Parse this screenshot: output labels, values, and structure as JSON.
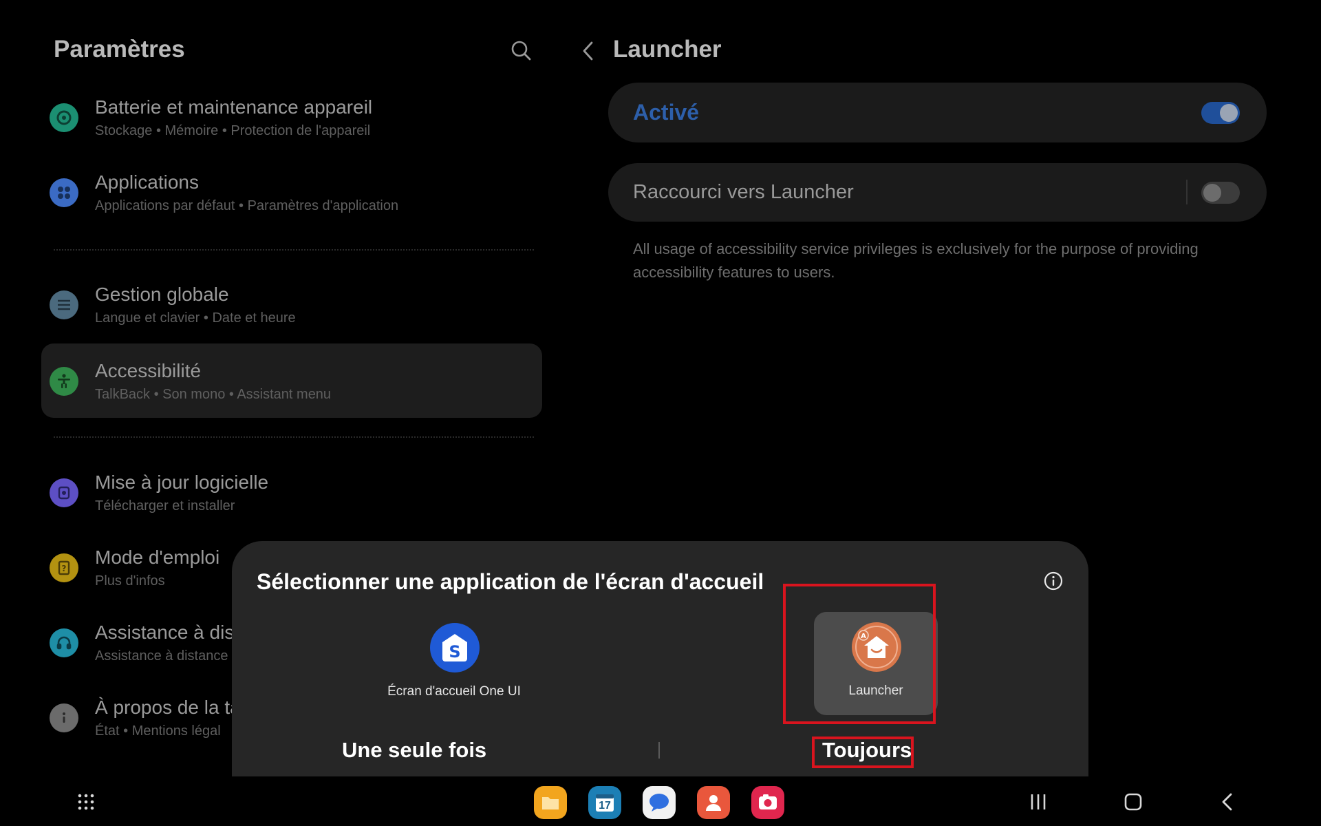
{
  "settings_pane": {
    "title": "Paramètres",
    "items": [
      {
        "title": "Batterie et maintenance appareil",
        "subtitle": "Stockage  •  Mémoire  •  Protection de l'appareil",
        "icon": "battery-care-icon",
        "color": "#1b8f72"
      },
      {
        "title": "Applications",
        "subtitle": "Applications par défaut  •  Paramètres d'application",
        "icon": "apps-grid-icon",
        "color": "#3b6bc4"
      },
      {
        "title": "Gestion globale",
        "subtitle": "Langue et clavier  •  Date et heure",
        "icon": "sliders-icon",
        "color": "#4b6a7e"
      },
      {
        "title": "Accessibilité",
        "subtitle": "TalkBack  •  Son mono  •  Assistant menu",
        "icon": "accessibility-icon",
        "color": "#2f8a46"
      },
      {
        "title": "Mise à jour logicielle",
        "subtitle": "Télécharger et installer",
        "icon": "software-update-icon",
        "color": "#5d4fc4"
      },
      {
        "title": "Mode d'emploi",
        "subtitle": "Plus d'infos",
        "icon": "manual-icon",
        "color": "#b39211"
      },
      {
        "title": "Assistance à dis",
        "subtitle": "Assistance à distance",
        "icon": "headset-icon",
        "color": "#1e8ea6"
      },
      {
        "title": "À propos de la ta",
        "subtitle": "État  •  Mentions légal",
        "icon": "info-icon",
        "color": "#6b6b6b"
      }
    ]
  },
  "detail_pane": {
    "title": "Launcher",
    "main_switch": {
      "label": "Activé",
      "state": "on"
    },
    "shortcut": {
      "label": "Raccourci vers Launcher",
      "state": "off"
    },
    "notice": "All usage of accessibility service privileges is exclusively for the purpose of providing accessibility features to users."
  },
  "dialog": {
    "title": "Sélectionner une application de l'écran d'accueil",
    "options": [
      {
        "name": "Écran d'accueil One UI",
        "icon": "one-ui-home-icon",
        "selected": false
      },
      {
        "name": "Launcher",
        "icon": "launcher-app-icon",
        "selected": true
      }
    ],
    "buttons": {
      "once": "Une seule fois",
      "always": "Toujours"
    }
  },
  "taskbar": {
    "apps": [
      "files-icon",
      "calendar-icon",
      "messages-icon",
      "contacts-icon",
      "camera-icon"
    ],
    "calendar_day": "17"
  },
  "colors": {
    "accent": "#2d5faa",
    "highlight": "#d9141e"
  }
}
